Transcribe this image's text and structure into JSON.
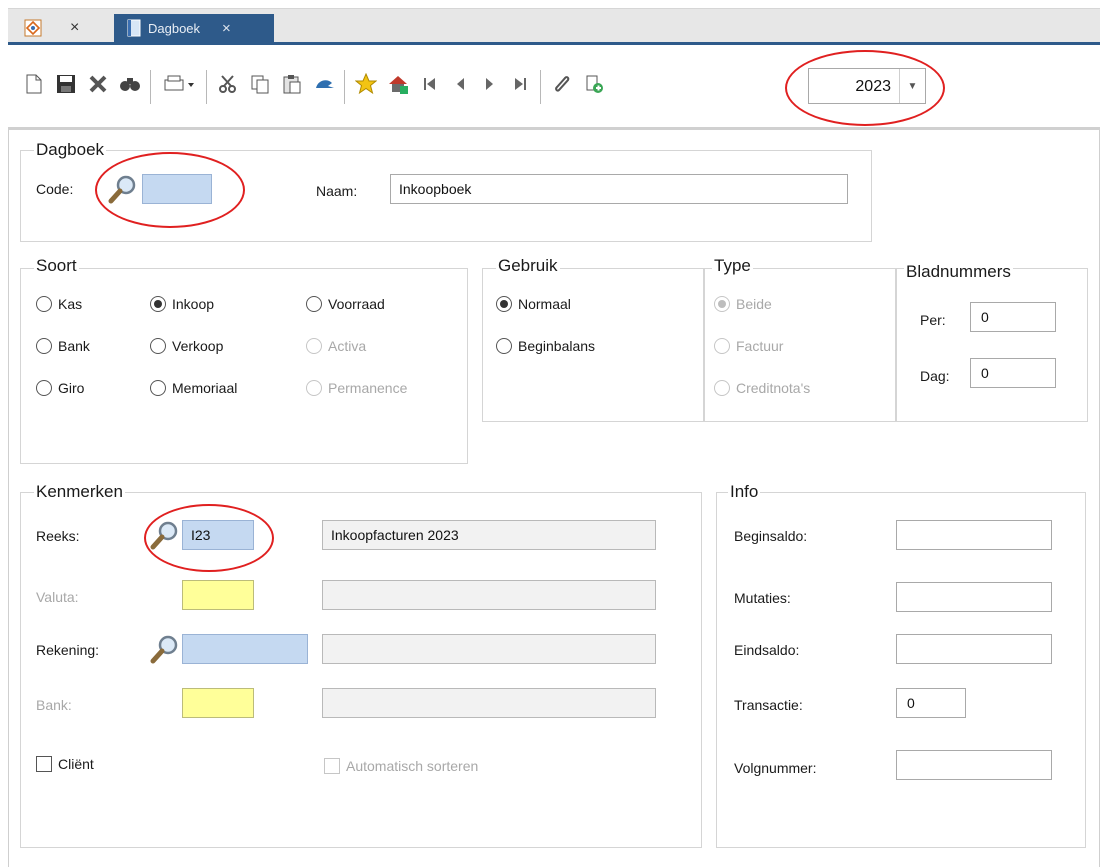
{
  "tabs": {
    "home_close": "×",
    "dagboek_title": "Dagboek",
    "dagboek_close": "×"
  },
  "toolbar": {
    "icons": [
      "new-icon",
      "save-icon",
      "delete-icon",
      "find-icon",
      "print-icon",
      "cut-icon",
      "copy-icon",
      "paste-icon",
      "undo-icon",
      "favorite-icon",
      "home-add-icon",
      "first-icon",
      "prev-icon",
      "next-icon",
      "last-icon",
      "attach-icon",
      "export-icon"
    ],
    "year": "2023",
    "year_dropdown": "▼"
  },
  "dagboek": {
    "legend": "Dagboek",
    "code_label": "Code:",
    "code_value": "",
    "naam_label": "Naam:",
    "naam_value": "Inkoopboek"
  },
  "soort": {
    "legend": "Soort",
    "options": [
      "Kas",
      "Inkoop",
      "Voorraad",
      "Bank",
      "Verkoop",
      "Activa",
      "Giro",
      "Memoriaal",
      "Permanence"
    ],
    "selected": "Inkoop"
  },
  "gebruik": {
    "legend": "Gebruik",
    "options": [
      "Normaal",
      "Beginbalans"
    ],
    "selected": "Normaal"
  },
  "type": {
    "legend": "Type",
    "options": [
      "Beide",
      "Factuur",
      "Creditnota's"
    ],
    "selected": "Beide"
  },
  "bladnummers": {
    "legend": "Bladnummers",
    "per_label": "Per:",
    "per_value": "0",
    "dag_label": "Dag:",
    "dag_value": "0"
  },
  "kenmerken": {
    "legend": "Kenmerken",
    "reeks_label": "Reeks:",
    "reeks_value": "I23",
    "reeks_desc": "Inkoopfacturen 2023",
    "valuta_label": "Valuta:",
    "rekening_label": "Rekening:",
    "bank_label": "Bank:",
    "client_label": "Cliënt",
    "autosort_label": "Automatisch sorteren"
  },
  "info": {
    "legend": "Info",
    "beginsaldo_label": "Beginsaldo:",
    "mutaties_label": "Mutaties:",
    "eindsaldo_label": "Eindsaldo:",
    "transactie_label": "Transactie:",
    "transactie_value": "0",
    "volgnummer_label": "Volgnummer:"
  },
  "colors": {
    "tab_active": "#2e5a8a",
    "input_blue": "#c5d9f1",
    "input_yellow": "#ffff99",
    "highlight": "#e02020"
  }
}
